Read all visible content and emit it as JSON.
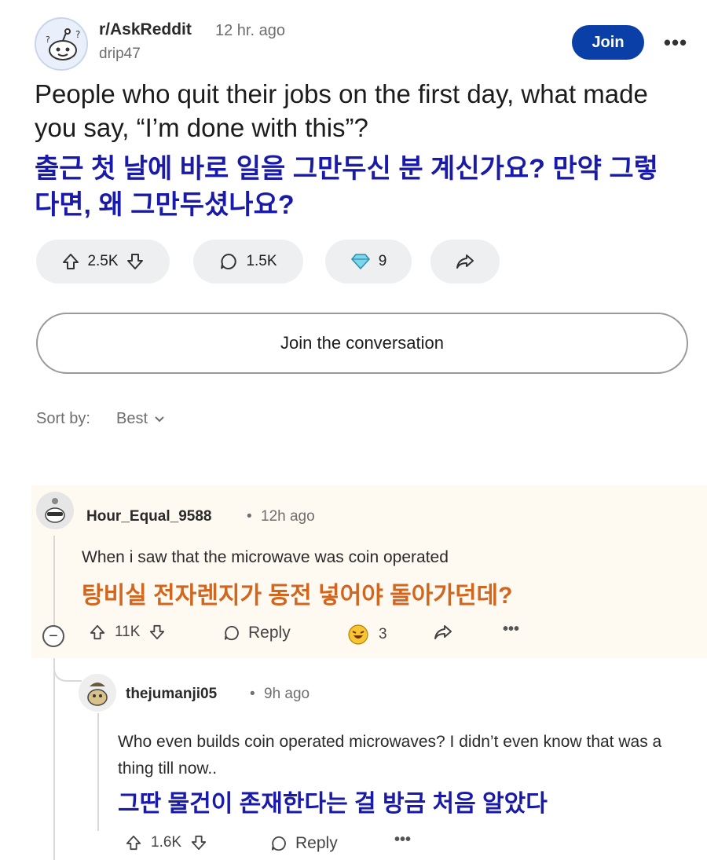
{
  "post": {
    "subreddit": "r/AskReddit",
    "time": "12 hr. ago",
    "author": "drip47",
    "join_label": "Join",
    "more_label": "•••",
    "title": "People who quit their jobs on the first day, what made you say, “I’m done with this”?",
    "title_ko": "출근 첫 날에 바로 일을 그만두신 분 계신가요? 만약 그렇다면, 왜 그만두셨나요?",
    "upvotes": "2.5K",
    "comments": "1.5K",
    "awards": "9"
  },
  "join_conversation": "Join the conversation",
  "sort": {
    "label": "Sort by:",
    "value": "Best"
  },
  "comments": [
    {
      "user": "Hour_Equal_9588",
      "dot": "•",
      "time": "12h ago",
      "text": "When i saw that the microwave was coin operated",
      "text_ko": "탕비실 전자렌지가 동전 넣어야 돌아가던데?",
      "votes": "11K",
      "reply_label": "Reply",
      "awards": "3",
      "more": "•••"
    },
    {
      "user": "thejumanji05",
      "dot": "•",
      "time": "9h ago",
      "text": "Who even builds coin operated microwaves? I didn’t even know that was a thing till now..",
      "text_ko": "그딴 물건이 존재한다는 걸 방금 처음 알았다",
      "votes": "1.6K",
      "reply_label": "Reply",
      "more": "•••"
    }
  ],
  "colors": {
    "join_button": "#0a3fa8",
    "korean_title": "#1a1aa8",
    "korean_comment_1": "#d2661e",
    "comment_highlight": "#fffaf1"
  },
  "icons": [
    "reddit-snoo-avatar",
    "upvote-icon",
    "downvote-icon",
    "comment-icon",
    "award-diamond-icon",
    "share-icon",
    "chevron-down-icon",
    "collapse-icon",
    "laugh-award-icon"
  ]
}
